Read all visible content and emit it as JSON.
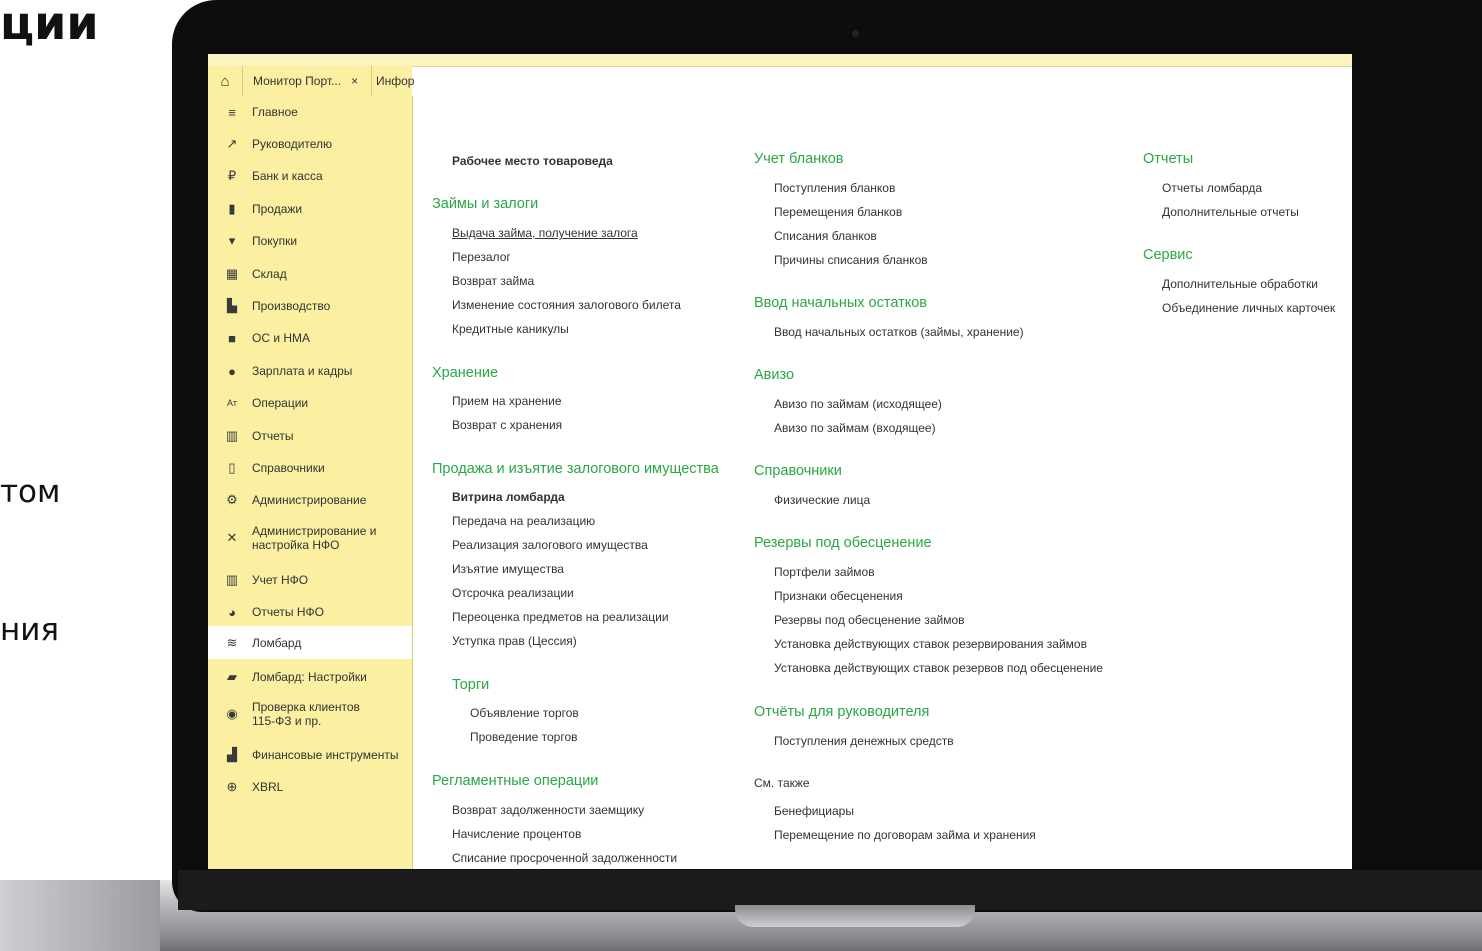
{
  "slide": {
    "fragment_top": "ции",
    "fragment_mid": "том",
    "fragment_low": "ния"
  },
  "tabs": {
    "tab1_label": "Монитор Порт...",
    "tab1_close": "×",
    "tab2_label": "Инфор"
  },
  "sidebar": {
    "items": [
      {
        "label": "Главное",
        "icon": "menu-icon"
      },
      {
        "label": "Руководителю",
        "icon": "trend-icon"
      },
      {
        "label": "Банк и касса",
        "icon": "ruble-icon"
      },
      {
        "label": "Продажи",
        "icon": "bag-icon"
      },
      {
        "label": "Покупки",
        "icon": "cart-icon"
      },
      {
        "label": "Склад",
        "icon": "warehouse-icon"
      },
      {
        "label": "Производство",
        "icon": "factory-icon"
      },
      {
        "label": "ОС и НМА",
        "icon": "truck-icon"
      },
      {
        "label": "Зарплата и кадры",
        "icon": "person-icon"
      },
      {
        "label": "Операции",
        "icon": "operations-icon"
      },
      {
        "label": "Отчеты",
        "icon": "bar-chart-icon"
      },
      {
        "label": "Справочники",
        "icon": "book-icon"
      },
      {
        "label": "Администрирование",
        "icon": "gear-icon"
      },
      {
        "label": "Администрирование и настройка НФО",
        "icon": "tools-icon"
      },
      {
        "label": "Учет НФО",
        "icon": "columns-icon"
      },
      {
        "label": "Отчеты НФО",
        "icon": "gauge-icon"
      },
      {
        "label": "Ломбард",
        "icon": "coins-icon"
      },
      {
        "label": "Ломбард: Настройки",
        "icon": "coins-gear-icon"
      },
      {
        "label": "Проверка клиентов 115-ФЗ и пр.",
        "icon": "eye-icon"
      },
      {
        "label": "Финансовые инструменты",
        "icon": "finance-chart-icon"
      },
      {
        "label": "XBRL",
        "icon": "xbrl-search-icon"
      }
    ]
  },
  "content": {
    "col1": {
      "workplace": "Рабочее место товароведа",
      "loans_head": "Займы и залоги",
      "loans": [
        "Выдача займа, получение залога",
        "Перезалог",
        "Возврат займа",
        "Изменение состояния залогового билета",
        "Кредитные каникулы"
      ],
      "storage_head": "Хранение",
      "storage": [
        "Прием на хранение",
        "Возврат с хранения"
      ],
      "sale_head": "Продажа и изъятие залогового имущества",
      "sale_bold": "Витрина ломбарда",
      "sale": [
        "Передача на реализацию",
        "Реализация залогового имущества",
        "Изъятие имущества",
        "Отсрочка реализации",
        "Переоценка предметов на реализации",
        "Уступка прав (Цессия)"
      ],
      "auction_head": "Торги",
      "auction": [
        "Объявление торгов",
        "Проведение торгов"
      ],
      "reg_head": "Регламентные операции",
      "reg": [
        "Возврат задолженности заемщику",
        "Начисление процентов",
        "Списание просроченной задолженности"
      ]
    },
    "col2": {
      "blanks_head": "Учет бланков",
      "blanks": [
        "Поступления бланков",
        "Перемещения бланков",
        "Списания бланков",
        "Причины списания бланков"
      ],
      "init_head": "Ввод начальных остатков",
      "init": [
        "Ввод начальных остатков (займы, хранение)"
      ],
      "aviso_head": "Авизо",
      "aviso": [
        "Авизо по займам (исходящее)",
        "Авизо по займам (входящее)"
      ],
      "ref_head": "Справочники",
      "ref": [
        "Физические лица"
      ],
      "reserve_head": "Резервы под обесценение",
      "reserve": [
        "Портфели займов",
        "Признаки обесценения",
        "Резервы под обесценение займов",
        "Установка действующих ставок резервирования займов",
        "Установка действующих ставок резервов под обесценение"
      ],
      "mgr_head": "Отчёты для руководителя",
      "mgr": [
        "Поступления денежных средств"
      ],
      "see_also": "См. также",
      "also": [
        "Бенефициары",
        "Перемещение по договорам займа и хранения"
      ]
    },
    "col3": {
      "reports_head": "Отчеты",
      "reports": [
        "Отчеты ломбарда",
        "Дополнительные отчеты"
      ],
      "service_head": "Сервис",
      "service": [
        "Дополнительные обработки",
        "Объединение личных карточек"
      ]
    }
  }
}
